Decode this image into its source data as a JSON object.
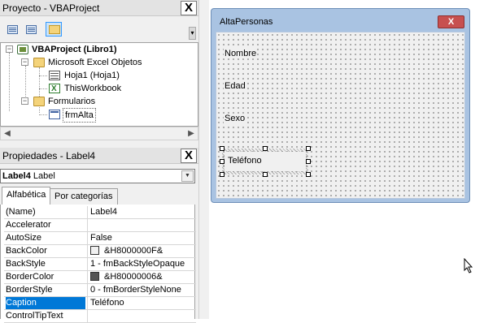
{
  "project": {
    "title": "Proyecto - VBAProject",
    "close": "X",
    "tree": {
      "root": "VBAProject (Libro1)",
      "excel_folder": "Microsoft Excel Objetos",
      "sheet": "Hoja1 (Hoja1)",
      "workbook": "ThisWorkbook",
      "forms_folder": "Formularios",
      "form": "frmAlta"
    }
  },
  "properties": {
    "title": "Propiedades - Label4",
    "close": "X",
    "object_name": "Label4",
    "object_type": "Label",
    "tabs": [
      "Alfabética",
      "Por categorías"
    ],
    "rows": [
      {
        "name": "(Name)",
        "value": "Label4"
      },
      {
        "name": "Accelerator",
        "value": ""
      },
      {
        "name": "AutoSize",
        "value": "False"
      },
      {
        "name": "BackColor",
        "value": "&H8000000F&"
      },
      {
        "name": "BackStyle",
        "value": "1 - fmBackStyleOpaque"
      },
      {
        "name": "BorderColor",
        "value": "&H80000006&"
      },
      {
        "name": "BorderStyle",
        "value": "0 - fmBorderStyleNone"
      },
      {
        "name": "Caption",
        "value": "Teléfono"
      },
      {
        "name": "ControlTipText",
        "value": ""
      }
    ]
  },
  "form": {
    "title": "AltaPersonas",
    "close": "X",
    "labels": [
      "Nombre",
      "Edad",
      "Sexo",
      "Teléfono"
    ]
  },
  "colors": {
    "selection": "#0078d7",
    "form_title_bg": "#a9c3e2",
    "close_button": "#c75050",
    "form_body": "#f0f0f0"
  }
}
